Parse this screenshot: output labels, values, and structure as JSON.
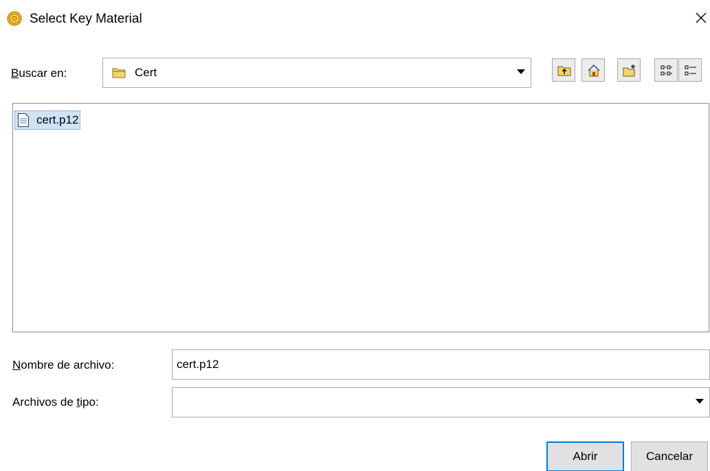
{
  "window": {
    "title": "Select Key Material",
    "app_icon": "ring-seal-icon",
    "close_icon": "close-icon"
  },
  "look_in": {
    "label_accel": "B",
    "label_rest": "uscar en:",
    "value": "Cert",
    "icon": "folder-icon"
  },
  "toolbar": {
    "buttons": [
      "up-folder-icon",
      "home-icon",
      "new-folder-icon",
      "list-view-icon",
      "details-view-icon"
    ]
  },
  "files": [
    {
      "name": "cert.p12",
      "icon": "file-icon",
      "selected": true
    }
  ],
  "file_name": {
    "label_accel": "N",
    "label_rest": "ombre de archivo:",
    "value": "cert.p12"
  },
  "file_type": {
    "label_pre": "Archivos de ",
    "label_accel": "t",
    "label_post": "ipo:",
    "value": ""
  },
  "buttons": {
    "open_label": "Abrir",
    "cancel_label": "Cancelar"
  },
  "colors": {
    "selection_bg": "#cfe3f7",
    "default_button_border": "#0078d7",
    "folder_yellow": "#f3d66b"
  }
}
